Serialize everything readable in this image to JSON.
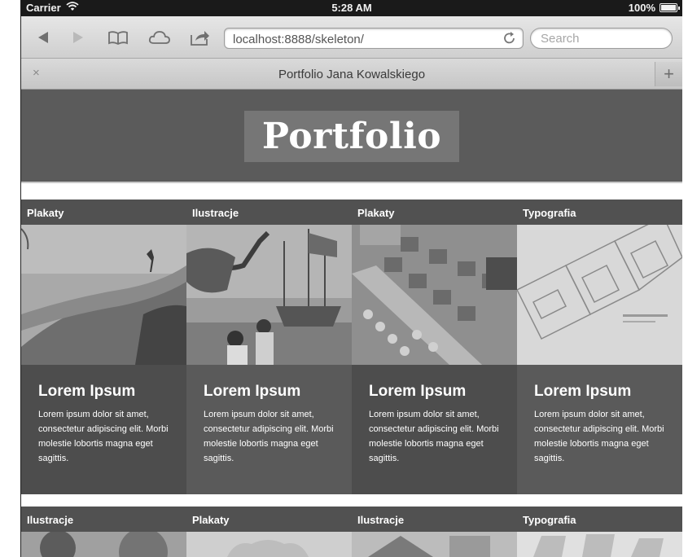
{
  "statusbar": {
    "carrier": "Carrier",
    "time": "5:28 AM",
    "battery": "100%",
    "icons": [
      "wifi-icon",
      "battery-icon"
    ]
  },
  "browser": {
    "url": "localhost:8888/skeleton/",
    "search_placeholder": "Search",
    "tab_title": "Portfolio Jana Kowalskiego",
    "tab_close": "×",
    "tab_add": "+",
    "toolbar_icons": [
      "back-icon",
      "forward-icon",
      "bookmarks-icon",
      "cloud-icon",
      "share-icon",
      "reload-icon"
    ]
  },
  "page": {
    "logo": "Portfolio"
  },
  "grid": {
    "row1": [
      {
        "category": "Plakaty",
        "title": "Lorem Ipsum",
        "text": "Lorem ipsum dolor sit amet, consectetur adipiscing elit. Morbi molestie lobortis magna eget sagittis."
      },
      {
        "category": "Ilustracje",
        "title": "Lorem Ipsum",
        "text": "Lorem ipsum dolor sit amet, consectetur adipiscing elit. Morbi molestie lobortis magna eget sagittis."
      },
      {
        "category": "Plakaty",
        "title": "Lorem Ipsum",
        "text": "Lorem ipsum dolor sit amet, consectetur adipiscing elit. Morbi molestie lobortis magna eget sagittis."
      },
      {
        "category": "Typografia",
        "title": "Lorem Ipsum",
        "text": "Lorem ipsum dolor sit amet, consectetur adipiscing elit. Morbi molestie lobortis magna eget sagittis."
      }
    ],
    "row2": [
      {
        "category": "Ilustracje"
      },
      {
        "category": "Plakaty"
      },
      {
        "category": "Ilustracje"
      },
      {
        "category": "Typografia"
      }
    ]
  },
  "colors": {
    "header_bg": "#5b5b5b",
    "label_bg": "#515151",
    "body_dark": "#4d4d4d",
    "body_mid": "#5a5a5a",
    "statusbar_bg": "#1a1a1a"
  }
}
